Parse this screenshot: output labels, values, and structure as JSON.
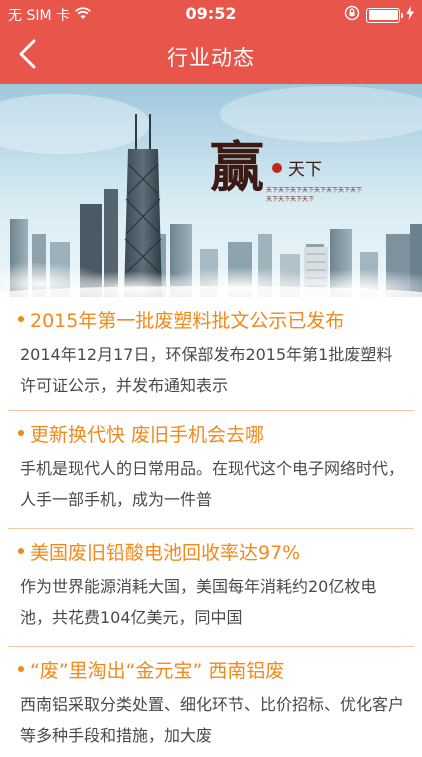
{
  "status_bar": {
    "carrier": "无 SIM 卡",
    "time": "09:52",
    "icons": [
      "wifi-icon",
      "rotation-lock-icon",
      "battery-icon",
      "charging-icon"
    ]
  },
  "navbar": {
    "title": "行业动态",
    "back_icon": "chevron-left-icon"
  },
  "banner": {
    "calligraphy": "赢",
    "subtitle": "天下",
    "small_text_1": "天下天下天下天下天下天下天下天下",
    "small_text_2": "天下天下天下天下"
  },
  "news": [
    {
      "title": "2015年第一批废塑料批文公示已发布",
      "summary": "2014年12月17日，环保部发布2015年第1批废塑料许可证公示，并发布通知表示"
    },
    {
      "title": "更新换代快 废旧手机会去哪",
      "summary": "手机是现代人的日常用品。在现代这个电子网络时代，人手一部手机，成为一件普"
    },
    {
      "title": "美国废旧铅酸电池回收率达97%",
      "summary": "作为世界能源消耗大国，美国每年消耗约20亿枚电池，共花费104亿美元，同中国"
    },
    {
      "title": "“废”里淘出“金元宝” 西南铝废",
      "summary": "西南铝采取分类处置、细化环节、比价招标、优化客户等多种手段和措施，加大废"
    }
  ],
  "colors": {
    "header": "#e8554a",
    "accent": "#f08a1c",
    "divider": "#f2c9a3"
  }
}
